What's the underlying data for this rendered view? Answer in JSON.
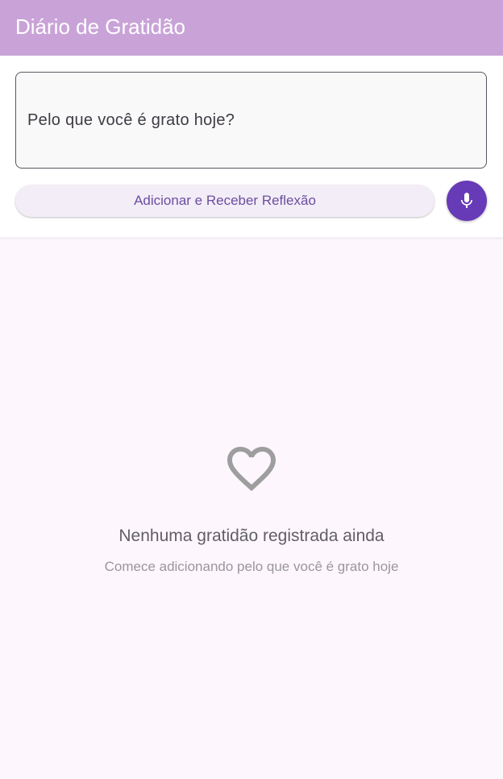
{
  "app_bar": {
    "title": "Diário de Gratidão",
    "background_color": "#c9a3d8"
  },
  "composer": {
    "input": {
      "placeholder": "Pelo que você é grato hoje?",
      "value": ""
    },
    "submit_button": {
      "label": "Adicionar e Receber Reflexão"
    },
    "mic_button": {
      "icon": "microphone-icon",
      "color": "#673ab7"
    }
  },
  "empty_state": {
    "icon": "heart-outline-icon",
    "title": "Nenhuma gratidão registrada ainda",
    "subtitle": "Comece adicionando pelo que você é grato hoje"
  }
}
